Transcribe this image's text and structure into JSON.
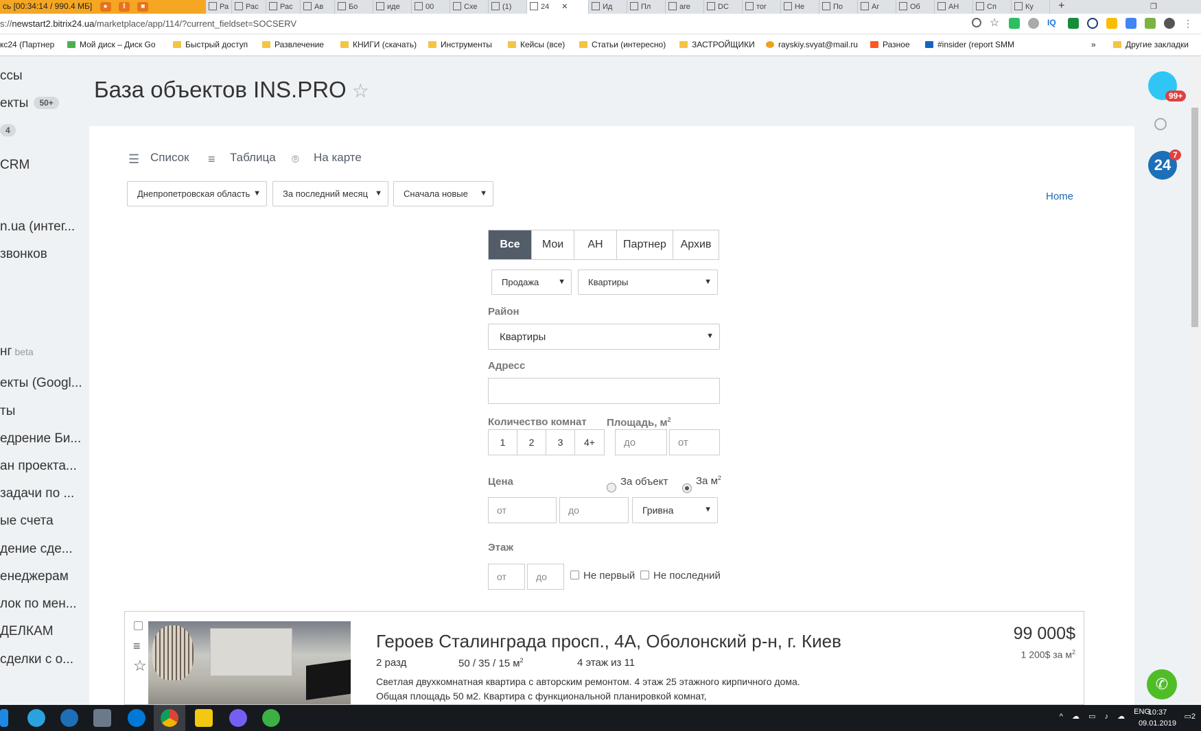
{
  "browser": {
    "recorder_text": "сь  [00:34:14 / 990.4 МБ]",
    "tabs": [
      "Ра",
      "Рас",
      "Рас",
      "Ав",
      "Бо",
      "иде",
      "00",
      "Схе",
      "(1)",
      "24",
      "Ид",
      "Пл",
      "are",
      "DC",
      "тог",
      "Не",
      "По",
      "Ar",
      "Об",
      "АН",
      "Сп",
      "Ку"
    ],
    "active_tab": "24",
    "url_prefix": "s://",
    "url_host": "newstart2.bitrix24.ua",
    "url_path": "/marketplace/app/114/?current_fieldset=SOCSERV",
    "bookmarks": [
      "кс24 (Партнер",
      "Мой диск – Диск Go",
      "Быстрый доступ",
      "Развлечение",
      "КНИГИ (скачать)",
      "Инструменты",
      "Кейсы (все)",
      "Статьи (интересно)",
      "ЗАСТРОЙЩИКИ",
      "rayskiy.svyat@mail.ru",
      "Разное",
      "#insider (report SMM",
      "»",
      "Другие закладки"
    ]
  },
  "sidebar": {
    "items": [
      {
        "label": "ссы"
      },
      {
        "label": "екты",
        "badge": "50+"
      },
      {
        "label": "",
        "badge": "4"
      },
      {
        "label": "CRM"
      },
      {
        "label": "n.ua (интег..."
      },
      {
        "label": "звонков"
      },
      {
        "label": "нг",
        "beta": "beta"
      },
      {
        "label": "екты (Googl..."
      },
      {
        "label": "ты"
      },
      {
        "label": "едрение Би..."
      },
      {
        "label": "ан проекта..."
      },
      {
        "label": "задачи по ..."
      },
      {
        "label": "ые счета"
      },
      {
        "label": "дение сде..."
      },
      {
        "label": "енеджерам"
      },
      {
        "label": "лок по мен..."
      },
      {
        "label": "ДЕЛКАМ"
      },
      {
        "label": "сделки с о..."
      }
    ]
  },
  "rightpanel": {
    "notifications_badge": "99+",
    "b24_label": "24",
    "b24_badge": "7"
  },
  "page": {
    "title": "База объектов INS.PRO",
    "star": "☆",
    "views": {
      "list": "Список",
      "table": "Таблица",
      "map": "На карте"
    },
    "filters": {
      "region": "Днепропетровская область",
      "period": "За последний месяц",
      "sort": "Сначала новые"
    },
    "home_link": "Home",
    "segments": [
      "Все",
      "Мои",
      "АН",
      "Партнер",
      "Архив"
    ],
    "active_segment": "Все",
    "deal_type": "Продажа",
    "property_type": "Квартиры",
    "district_label": "Район",
    "district_value": "Квартиры",
    "address_label": "Адресс",
    "address_value": "",
    "rooms_label": "Количество комнат",
    "rooms": [
      "1",
      "2",
      "3",
      "4+"
    ],
    "area_label": "Площадь, м",
    "area_sup": "2",
    "area_to_placeholder": "до",
    "area_from_placeholder": "от",
    "price_label": "Цена",
    "price_per_object": "За объект",
    "price_per_m2": "За м",
    "price_per_m2_sup": "2",
    "price_from_placeholder": "от",
    "price_to_placeholder": "до",
    "currency": "Гривна",
    "floor_label": "Этаж",
    "floor_from_placeholder": "от",
    "floor_to_placeholder": "до",
    "not_first": "Не первый",
    "not_last": "Не последний"
  },
  "listing": {
    "title": "Героев Сталинграда просп., 4А, Оболонский р-н, г. Киев",
    "rooms": "2 разд",
    "area": "50 / 35 / 15 м",
    "area_sup": "2",
    "floor": "4 этаж из 11",
    "description": "Светлая двухкомнатная квартира с авторским ремонтом. 4 этаж 25 этажного кирпичного дома. Общая площадь 50 м2. Квартира с функциональной планировкой комнат,",
    "price": "99 000$",
    "price_per_m2": "1 200$ за м",
    "price_per_m2_sup": "2"
  },
  "taskbar": {
    "language": "ENG",
    "time": "10:37",
    "date": "09.01.2019",
    "notifications": "2"
  }
}
